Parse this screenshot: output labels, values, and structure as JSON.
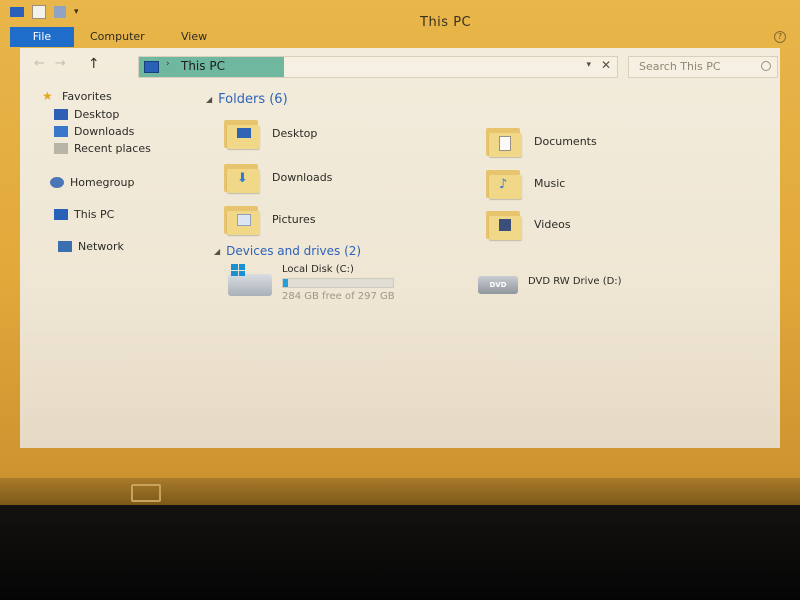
{
  "window": {
    "title": "This PC"
  },
  "ribbon": {
    "tabs": [
      "File",
      "Computer",
      "View"
    ],
    "help": "?"
  },
  "address": {
    "path": "This PC",
    "dropdown": "▾",
    "clear": "✕"
  },
  "search": {
    "placeholder": "Search This PC"
  },
  "nav": {
    "back": "←",
    "forward": "→",
    "up": "↑"
  },
  "navigation_pane": {
    "items": [
      {
        "label": "Favorites",
        "icon": "star-icon"
      },
      {
        "label": "Desktop",
        "icon": "desktop-icon"
      },
      {
        "label": "Downloads",
        "icon": "downloads-icon"
      },
      {
        "label": "Recent places",
        "icon": "recent-places-icon"
      },
      {
        "label": "Homegroup",
        "icon": "homegroup-icon"
      },
      {
        "label": "This PC",
        "icon": "computer-icon"
      },
      {
        "label": "Network",
        "icon": "network-icon"
      }
    ]
  },
  "folders": {
    "heading": "Folders (6)",
    "items": [
      {
        "label": "Desktop",
        "icon": "desktop-folder-icon"
      },
      {
        "label": "Documents",
        "icon": "documents-folder-icon"
      },
      {
        "label": "Downloads",
        "icon": "downloads-folder-icon"
      },
      {
        "label": "Music",
        "icon": "music-folder-icon"
      },
      {
        "label": "Pictures",
        "icon": "pictures-folder-icon"
      },
      {
        "label": "Videos",
        "icon": "videos-folder-icon"
      }
    ]
  },
  "devices": {
    "heading": "Devices and drives (2)",
    "items": [
      {
        "label": "Local Disk (C:)",
        "free": "284 GB free of 297 GB",
        "used_fraction": 0.044,
        "icon": "local-disk-icon"
      },
      {
        "label": "DVD RW Drive (D:)",
        "icon": "dvd-drive-icon",
        "badge": "DVD"
      }
    ]
  },
  "colors": {
    "accent": "#1f6dcb",
    "heading": "#2e63b8",
    "address_highlight": "#6fb79f"
  }
}
